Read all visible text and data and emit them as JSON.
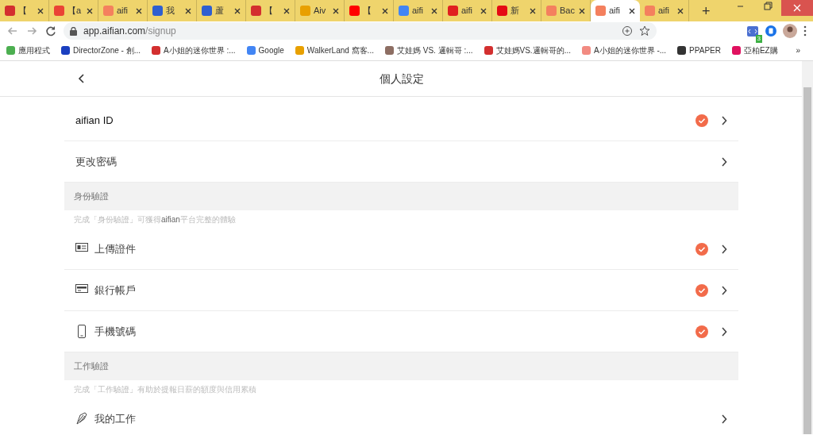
{
  "browser": {
    "tabs": [
      {
        "title": "【",
        "color": "#d32f2f",
        "selected": false
      },
      {
        "title": "【a",
        "color": "#ea4335",
        "selected": false
      },
      {
        "title": "aifi",
        "color": "#f4805e",
        "selected": false
      },
      {
        "title": "我",
        "color": "#2f5fd0",
        "selected": false
      },
      {
        "title": "蘆",
        "color": "#2f5fd0",
        "selected": false
      },
      {
        "title": "【",
        "color": "#d32f2f",
        "selected": false
      },
      {
        "title": "Aiv",
        "color": "#e8a000",
        "selected": false
      },
      {
        "title": "【",
        "color": "#ff0000",
        "selected": false
      },
      {
        "title": "aifi",
        "color": "#4285f4",
        "selected": false
      },
      {
        "title": "aifi",
        "color": "#e02020",
        "selected": false
      },
      {
        "title": "新",
        "color": "#e50914",
        "selected": false
      },
      {
        "title": "Bac",
        "color": "#f4805e",
        "selected": false
      },
      {
        "title": "aifi",
        "color": "#f4805e",
        "selected": true
      },
      {
        "title": "aifi",
        "color": "#f4805e",
        "selected": false
      }
    ],
    "new_tab": "+",
    "url_host": "app.aifian.com",
    "url_path": "/signup",
    "extension_badge": "3",
    "bookmarks": [
      {
        "title": "應用程式",
        "color": "#4caf50"
      },
      {
        "title": "DirectorZone - 創...",
        "color": "#1a3fc0"
      },
      {
        "title": "A小姐的迷你世界 :...",
        "color": "#d32f2f"
      },
      {
        "title": "Google",
        "color": "#4285f4"
      },
      {
        "title": "WalkerLand 窩客...",
        "color": "#e8a000"
      },
      {
        "title": "艾娃媽 VS. 邏輯哥 :...",
        "color": "#8d6e63"
      },
      {
        "title": "艾娃媽VS.邏輯哥的...",
        "color": "#d32f2f"
      },
      {
        "title": "A小姐的迷你世界 -...",
        "color": "#f28b82"
      },
      {
        "title": "PPAPER",
        "color": "#333333"
      },
      {
        "title": "亞柏EZ購",
        "color": "#e0115f"
      }
    ],
    "bookmarks_more": "»"
  },
  "page": {
    "title": "個人設定",
    "settings": [
      {
        "kind": "row",
        "label": "aifian ID",
        "verified": true
      },
      {
        "kind": "row",
        "label": "更改密碼",
        "verified": false
      },
      {
        "kind": "section",
        "title": "身份驗證"
      },
      {
        "kind": "note",
        "text": "完成「身份驗證」可獲得**aifian**平台完整的體驗"
      },
      {
        "kind": "document",
        "label": "上傳證件",
        "verified": true
      },
      {
        "kind": "bank",
        "label": "銀行帳戶",
        "verified": true
      },
      {
        "kind": "phone",
        "label": "手機號碼",
        "verified": true
      },
      {
        "kind": "section",
        "title": "工作驗證"
      },
      {
        "kind": "note",
        "text": "完成「工作驗證」有助於提報日薪的額度與信用累積"
      },
      {
        "kind": "job",
        "label": "我的工作",
        "verified": false
      }
    ]
  }
}
